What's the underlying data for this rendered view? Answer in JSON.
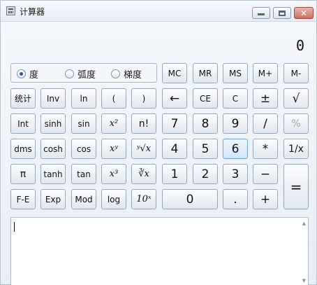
{
  "window": {
    "title": "计算器",
    "min_glyph": "minimize-icon",
    "max_glyph": "maximize-icon",
    "close_label": "✕"
  },
  "display": {
    "value": "0"
  },
  "angle_modes": [
    {
      "label": "度",
      "selected": true
    },
    {
      "label": "弧度",
      "selected": false
    },
    {
      "label": "梯度",
      "selected": false
    }
  ],
  "keys": {
    "mc": "MC",
    "mr": "MR",
    "ms": "MS",
    "mplus": "M+",
    "mminus": "M-",
    "stat": "统计",
    "inv": "Inv",
    "ln": "ln",
    "lparen": "(",
    "rparen": ")",
    "back": "←",
    "ce": "CE",
    "c": "C",
    "plusminus": "±",
    "sqrt": "√",
    "int": "Int",
    "sinh": "sinh",
    "sin": "sin",
    "xsq": "x²",
    "fact": "n!",
    "d7": "7",
    "d8": "8",
    "d9": "9",
    "div": "/",
    "pct": "%",
    "dms": "dms",
    "cosh": "cosh",
    "cos": "cos",
    "xpowy": "xʸ",
    "yrootx": "ʸ√x",
    "d4": "4",
    "d5": "5",
    "d6": "6",
    "mul": "*",
    "recip": "1/x",
    "pi": "π",
    "tanh": "tanh",
    "tan": "tan",
    "xcube": "x³",
    "cuberoot": "∛x",
    "d1": "1",
    "d2": "2",
    "d3": "3",
    "sub": "−",
    "eq": "=",
    "fe": "F-E",
    "exp": "Exp",
    "mod": "Mod",
    "log": "log",
    "tenx": "10ˣ",
    "d0": "0",
    "dot": ".",
    "add": "+"
  },
  "history": {
    "scroll_up": "▲",
    "scroll_down": "▼"
  }
}
